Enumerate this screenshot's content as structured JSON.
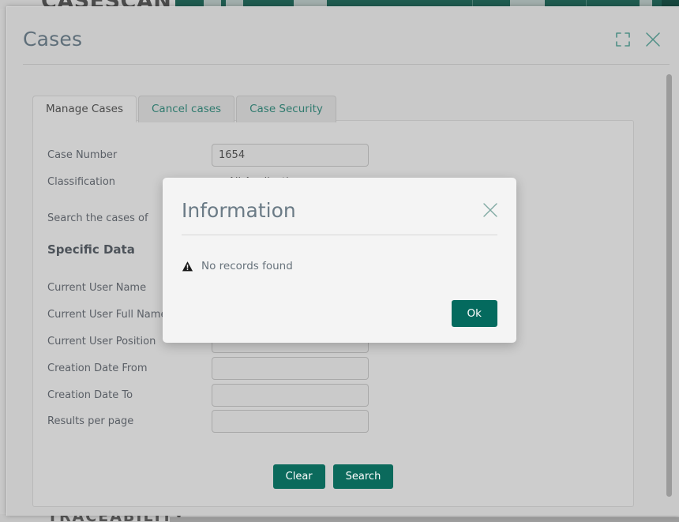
{
  "background": {
    "logo_text": "CASESCAN",
    "bottom_text": "TRACEABILITY"
  },
  "window": {
    "title": "Cases",
    "expand_icon": "expand-icon",
    "close_icon": "close-icon"
  },
  "tabs": [
    {
      "label": "Manage Cases",
      "active": true
    },
    {
      "label": "Cancel cases",
      "active": false
    },
    {
      "label": "Case Security",
      "active": false
    }
  ],
  "form": {
    "rows": [
      {
        "label": "Case Number",
        "type": "input",
        "value": "1654",
        "placeholder": ""
      },
      {
        "label": "Classification",
        "type": "link",
        "value": "All Applications"
      },
      {
        "label": "Search the cases of",
        "type": "none",
        "value": ""
      },
      {
        "label": "Specific Data",
        "type": "heading",
        "value": ""
      },
      {
        "label": "Current User Name",
        "type": "input",
        "value": "",
        "placeholder": ""
      },
      {
        "label": "Current User Full Name",
        "type": "input",
        "value": "",
        "placeholder": ""
      },
      {
        "label": "Current User Position",
        "type": "input",
        "value": "",
        "placeholder": ""
      },
      {
        "label": "Creation Date From",
        "type": "input",
        "value": "",
        "placeholder": ""
      },
      {
        "label": "Creation Date To",
        "type": "input",
        "value": "",
        "placeholder": ""
      },
      {
        "label": "Results per page",
        "type": "input",
        "value": "",
        "placeholder": ""
      }
    ],
    "clear_label": "Clear",
    "search_label": "Search"
  },
  "dialog": {
    "title": "Information",
    "message": "No records found",
    "ok_label": "Ok",
    "close_icon": "close-icon",
    "warning_icon": "warning-triangle-icon"
  },
  "colors": {
    "accent_green": "#046a5e",
    "tab_link_teal": "#2f7a6e",
    "title_slate": "#5f6f7a",
    "marker_red": "#9c1a1a",
    "topbar_green": "#1f5c50"
  }
}
